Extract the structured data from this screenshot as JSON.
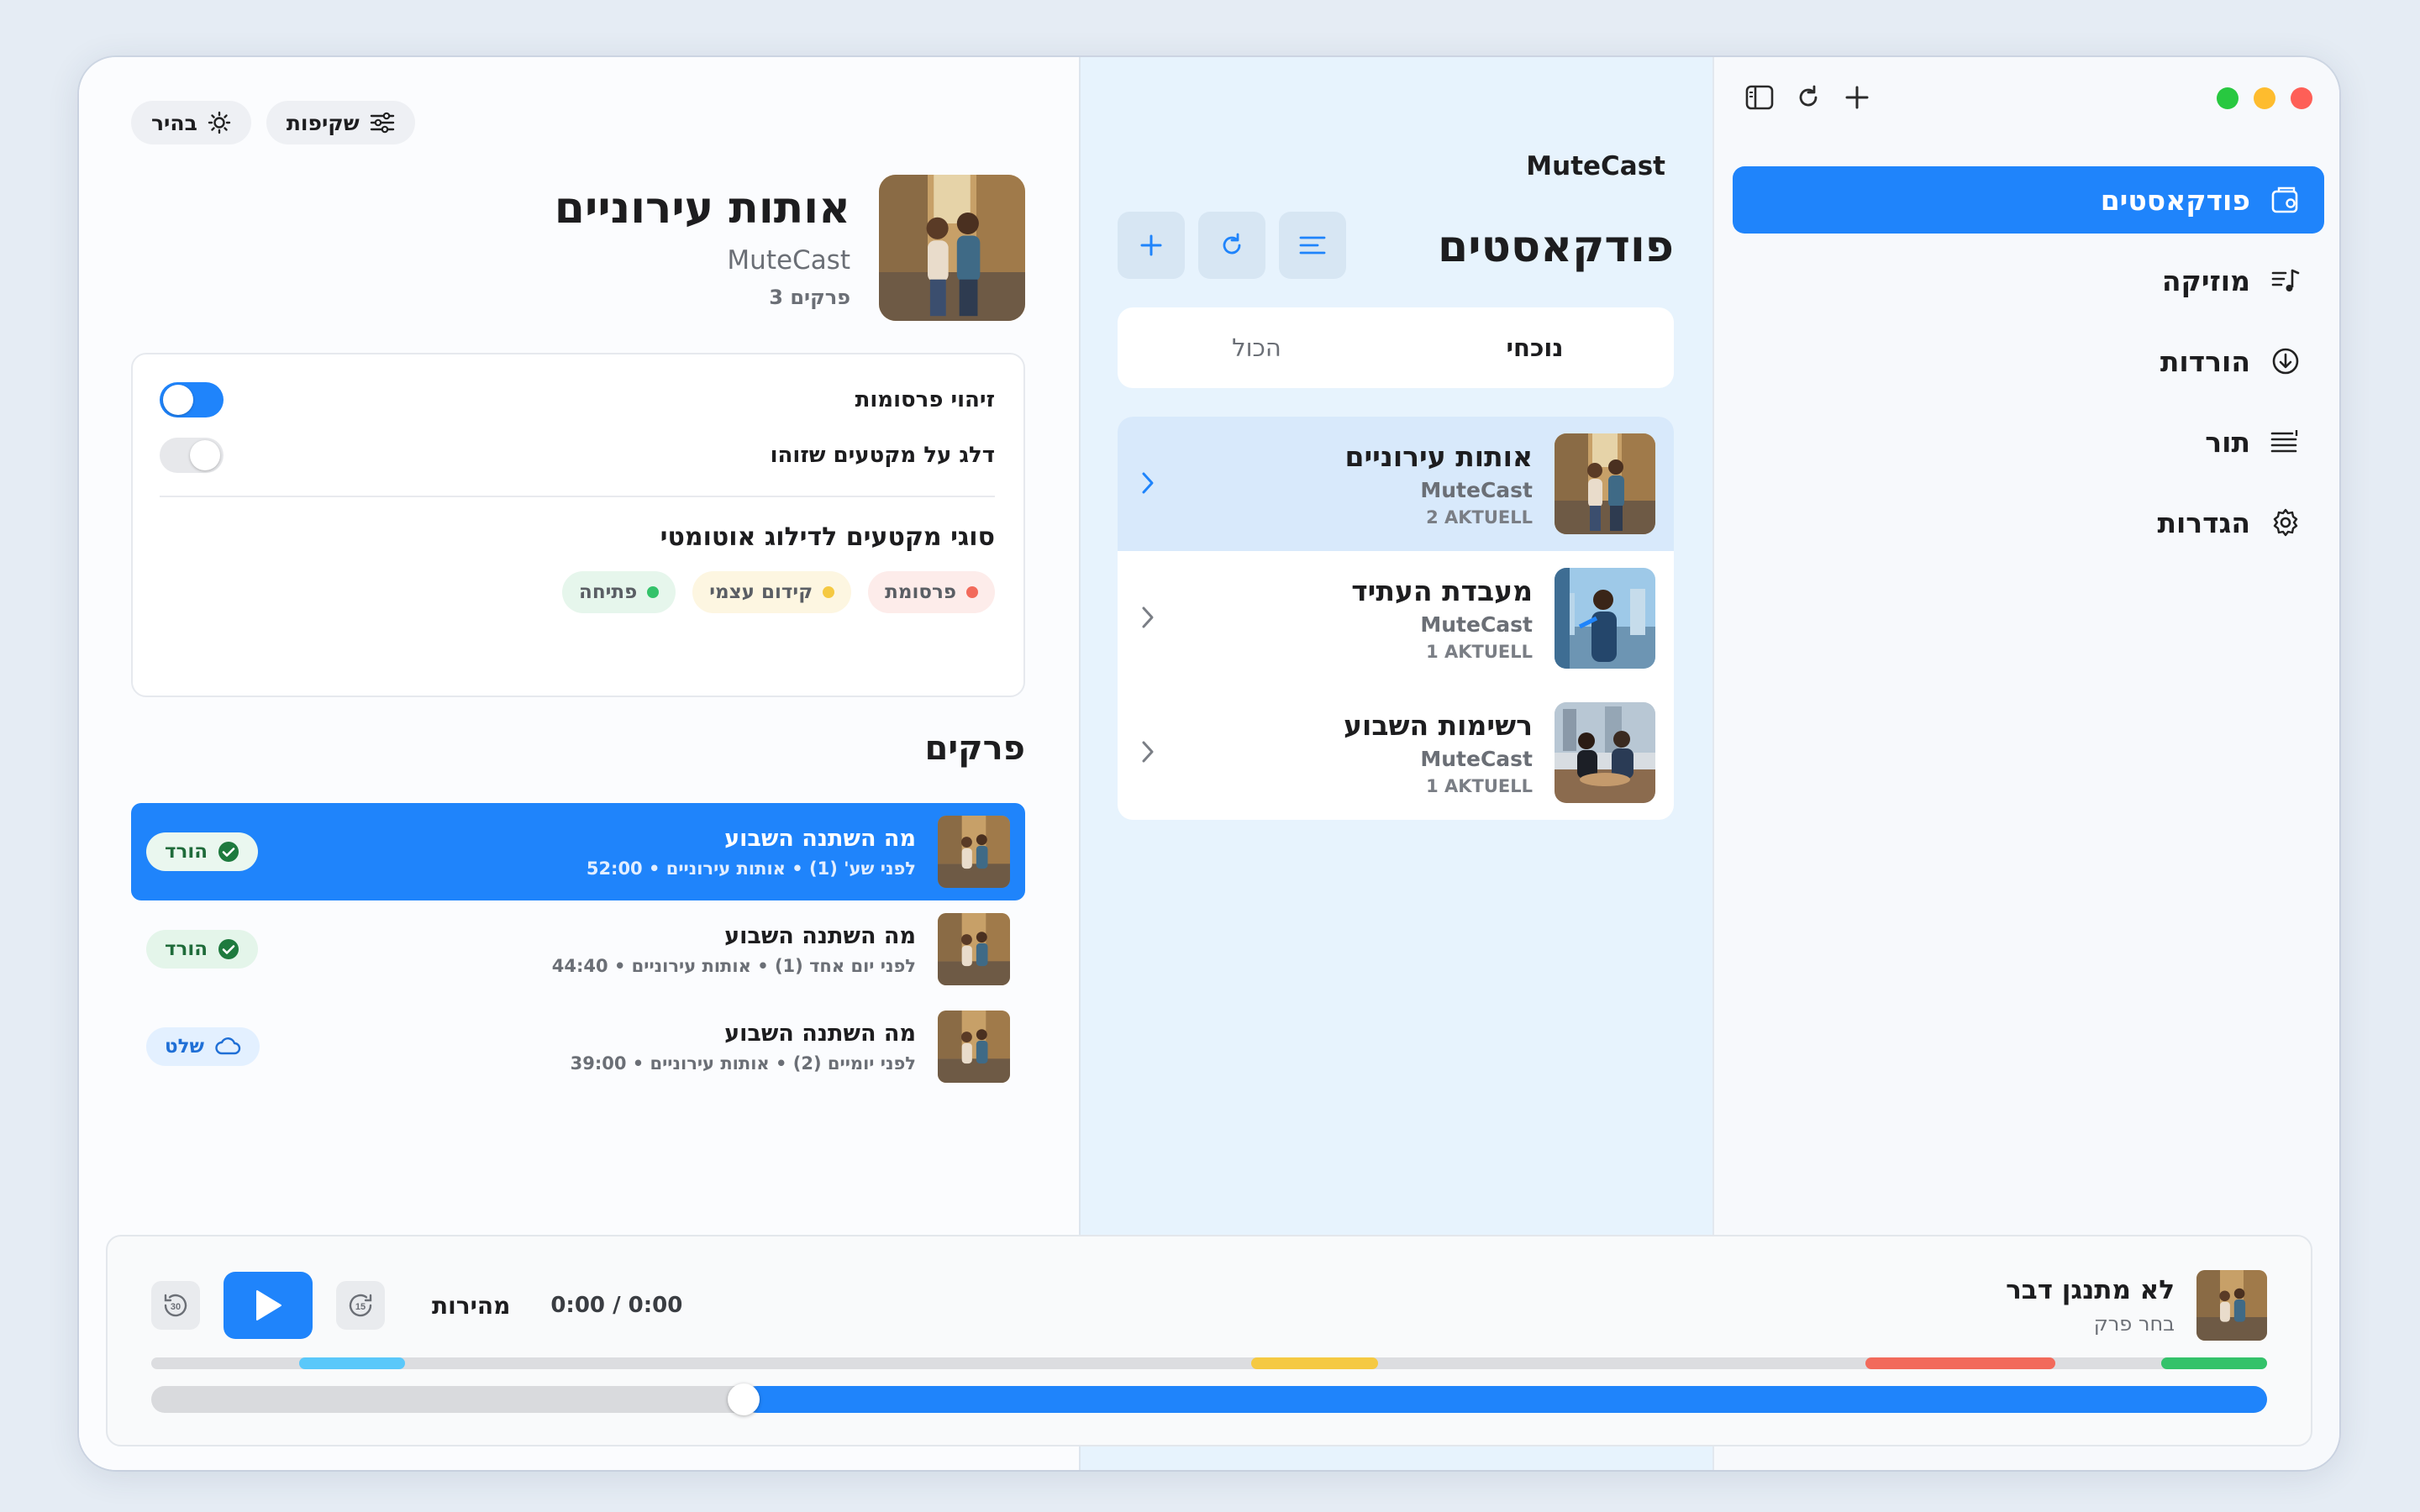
{
  "sidebar": {
    "nav": [
      {
        "label": "פודקאסטים",
        "icon": "podcast-icon",
        "active": true
      },
      {
        "label": "מוזיקה",
        "icon": "music-icon",
        "active": false
      },
      {
        "label": "הורדות",
        "icon": "download-icon",
        "active": false
      },
      {
        "label": "תור",
        "icon": "queue-icon",
        "active": false
      },
      {
        "label": "הגדרות",
        "icon": "gear-icon",
        "active": false
      }
    ]
  },
  "middle": {
    "app_name": "MuteCast",
    "title": "פודקאסטים",
    "tabs": [
      {
        "label": "נוכחי",
        "active": true
      },
      {
        "label": "הכול",
        "active": false
      }
    ],
    "podcasts": [
      {
        "title": "אותות עירוניים",
        "author": "MuteCast",
        "meta": "2 AKTUELL",
        "selected": true
      },
      {
        "title": "מעבדת העתיד",
        "author": "MuteCast",
        "meta": "1 AKTUELL",
        "selected": false
      },
      {
        "title": "רשימות השבוע",
        "author": "MuteCast",
        "meta": "1 AKTUELL",
        "selected": false
      }
    ]
  },
  "detail": {
    "pill_transparency": "שקיפות",
    "pill_theme": "בהיר",
    "title": "אותות עירוניים",
    "author": "MuteCast",
    "episode_count": "3 פרקים",
    "ad_detection_label": "זיהוי פרסומות",
    "ad_detection_on": true,
    "skip_detected_label": "דלג על מקטעים שזוהו",
    "skip_detected_on": false,
    "auto_skip_title": "סוגי מקטעים לדילוג אוטומטי",
    "chips": [
      {
        "label": "פרסומת",
        "kind": "ad"
      },
      {
        "label": "קידום עצמי",
        "kind": "self"
      },
      {
        "label": "פתיחה",
        "kind": "open"
      }
    ],
    "episodes_title": "פרקים",
    "episodes": [
      {
        "title": "מה השתנה השבוע",
        "meta": "52:00 • לפני שע' (1) • אותות עירוניים",
        "badge": "הורד",
        "badge_type": "downloaded",
        "selected": true
      },
      {
        "title": "מה השתנה השבוע",
        "meta": "44:40 • לפני יום אחד (1) • אותות עירוניים",
        "badge": "הורד",
        "badge_type": "downloaded",
        "selected": false
      },
      {
        "title": "מה השתנה השבוע",
        "meta": "39:00 • לפני יומיים (2) • אותות עירוניים",
        "badge": "שלט",
        "badge_type": "cloud",
        "selected": false
      }
    ]
  },
  "player": {
    "now_title": "לא מתנגן דבר",
    "now_sub": "בחר פרק",
    "speed_label": "מהירות",
    "time": "0:00 / 0:00",
    "back_seconds": "30",
    "forward_seconds": "15",
    "progress_fraction": 0.72
  },
  "colors": {
    "accent": "#1f84fb",
    "ad": "#f26a5b",
    "self_promo": "#f5c942",
    "intro": "#34c26a",
    "marker_blue": "#5ac8fa"
  }
}
